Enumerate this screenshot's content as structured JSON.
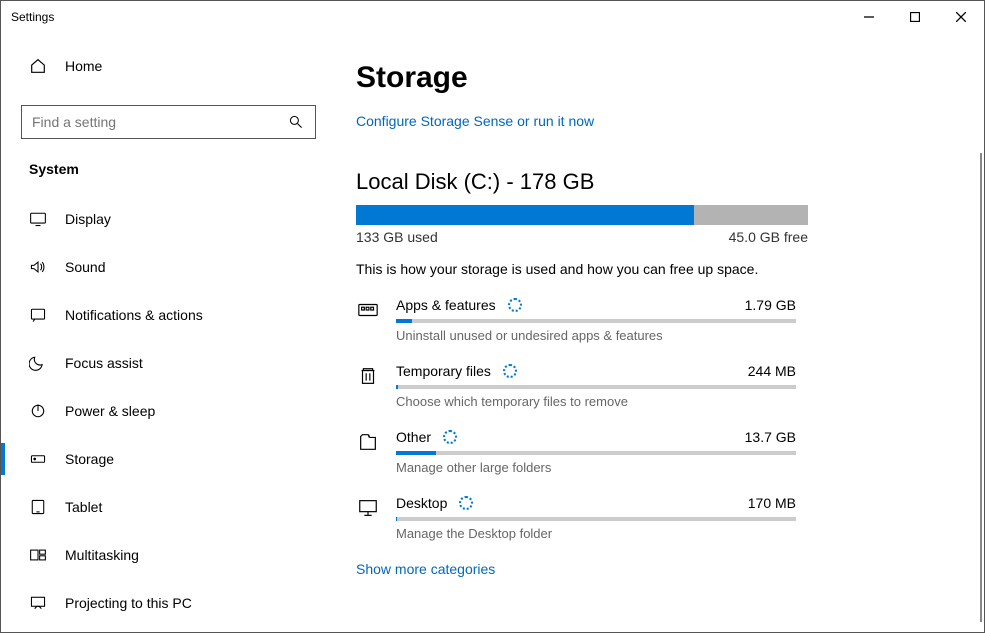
{
  "window": {
    "title": "Settings"
  },
  "sidebar": {
    "home": "Home",
    "search_placeholder": "Find a setting",
    "category": "System",
    "items": [
      {
        "label": "Display"
      },
      {
        "label": "Sound"
      },
      {
        "label": "Notifications & actions"
      },
      {
        "label": "Focus assist"
      },
      {
        "label": "Power & sleep"
      },
      {
        "label": "Storage"
      },
      {
        "label": "Tablet"
      },
      {
        "label": "Multitasking"
      },
      {
        "label": "Projecting to this PC"
      }
    ]
  },
  "main": {
    "heading": "Storage",
    "config_link": "Configure Storage Sense or run it now",
    "disk_title": "Local Disk (C:) - 178 GB",
    "used_label": "133 GB used",
    "free_label": "45.0 GB free",
    "usage_desc": "This is how your storage is used and how you can free up space.",
    "show_more": "Show more categories",
    "disk_fill_pct": 74.7,
    "categories": [
      {
        "title": "Apps & features",
        "size": "1.79 GB",
        "sub": "Uninstall unused or undesired apps & features",
        "fill": 4
      },
      {
        "title": "Temporary files",
        "size": "244 MB",
        "sub": "Choose which temporary files to remove",
        "fill": 0
      },
      {
        "title": "Other",
        "size": "13.7 GB",
        "sub": "Manage other large folders",
        "fill": 10
      },
      {
        "title": "Desktop",
        "size": "170 MB",
        "sub": "Manage the Desktop folder",
        "fill": 0
      }
    ]
  }
}
